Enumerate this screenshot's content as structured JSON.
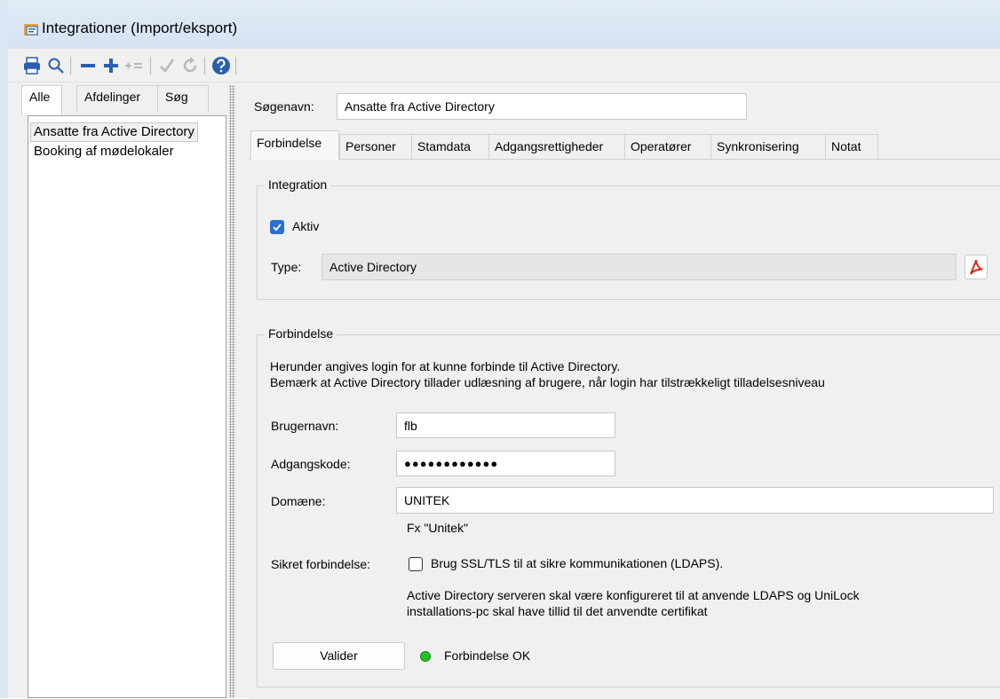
{
  "window": {
    "title": "Integrationer (Import/eksport)"
  },
  "left_tabs": [
    "Alle",
    "Afdelinger",
    "Søg"
  ],
  "list_items": [
    "Ansatte fra Active Directory",
    "Booking af mødelokaler"
  ],
  "search": {
    "label": "Søgenavn:",
    "value": "Ansatte fra Active Directory"
  },
  "tabs": [
    "Forbindelse",
    "Personer",
    "Stamdata",
    "Adgangsrettigheder",
    "Operatører",
    "Synkronisering",
    "Notat"
  ],
  "integration": {
    "group_title": "Integration",
    "active_label": "Aktiv",
    "type_label": "Type:",
    "type_value": "Active Directory"
  },
  "connection": {
    "group_title": "Forbindelse",
    "info_line1": "Herunder angives login for at kunne forbinde til Active Directory.",
    "info_line2": "Bemærk at Active Directory tillader udlæsning af brugere, når login har tilstrækkeligt tilladelsesniveau",
    "username_label": "Brugernavn:",
    "username_value": "flb",
    "password_label": "Adgangskode:",
    "password_value": "●●●●●●●●●●●●",
    "domain_label": "Domæne:",
    "domain_value": "UNITEK",
    "domain_hint": "Fx \"Unitek\"",
    "secure_label": "Sikret forbindelse:",
    "ssl_label": "Brug SSL/TLS til at sikre kommunikationen (LDAPS).",
    "note_line1": "Active Directory serveren skal være konfigureret til at anvende LDAPS og UniLock",
    "note_line2": "installations-pc skal have tillid til det anvendte certifikat",
    "validate_button": "Valider",
    "status": "Forbindelse OK"
  },
  "colors": {
    "accent": "#2b6fd6",
    "status_ok": "#22c422",
    "toolbar_blue": "#2a5fb0"
  }
}
